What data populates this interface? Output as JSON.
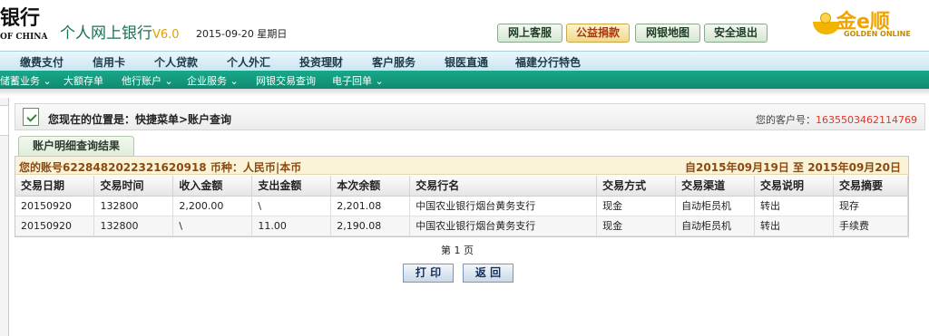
{
  "header": {
    "bank_name": "银行",
    "bank_en": "OF CHINA",
    "app_title": "个人网上银行",
    "version": "V6.0",
    "date": "2015-09-20 星期日",
    "buttons": [
      "网上客服",
      "公益捐款",
      "网银地图",
      "安全退出"
    ],
    "logo_text": "金e顺",
    "logo_sub": "GOLDEN ONLINE"
  },
  "nav_main": [
    "缴费支付",
    "信用卡",
    "个人贷款",
    "个人外汇",
    "投资理财",
    "客户服务",
    "银医直通",
    "福建分行特色"
  ],
  "nav_sub": [
    "储蓄业务 ⌄",
    "大额存单",
    "他行账户 ⌄",
    "企业服务 ⌄",
    "网银交易查询",
    "电子回单 ⌄"
  ],
  "location": {
    "label": "您现在的位置是：快捷菜单>账户查询",
    "customer_label": "您的客户号：",
    "customer_no": "1635503462114769"
  },
  "tab": "账户明细查询结果",
  "account_bar": {
    "left": "您的账号6228482022321620918 币种：人民币|本币",
    "right": "自2015年09月19日 至 2015年09月20日"
  },
  "table": {
    "headers": [
      "交易日期",
      "交易时间",
      "收入金额",
      "支出金额",
      "本次余额",
      "交易行名",
      "交易方式",
      "交易渠道",
      "交易说明",
      "交易摘要"
    ],
    "rows": [
      [
        "20150920",
        "132800",
        "2,200.00",
        "\\",
        "2,201.08",
        "中国农业银行烟台黄务支行",
        "现金",
        "自动柜员机",
        "转出",
        "现存"
      ],
      [
        "20150920",
        "132800",
        "\\",
        "11.00",
        "2,190.08",
        "中国农业银行烟台黄务支行",
        "现金",
        "自动柜员机",
        "转出",
        "手续费"
      ]
    ]
  },
  "page_number": "第 1 页",
  "actions": {
    "print": "打 印",
    "back": "返 回"
  }
}
